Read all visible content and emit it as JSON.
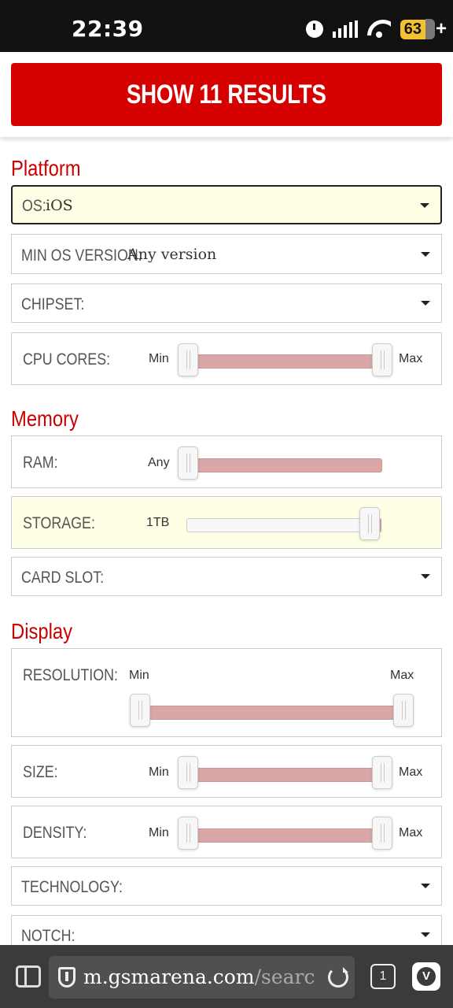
{
  "status_bar": {
    "time": "22:39",
    "battery_level": "63",
    "battery_plus": "+"
  },
  "top": {
    "show_results_label": "SHOW 11 RESULTS",
    "accent_color": "#d50000"
  },
  "sections": {
    "platform": {
      "title": "Platform",
      "os_label": "OS:",
      "os_value": "iOS",
      "min_os_label": "MIN OS VERSION:",
      "min_os_value": "Any version",
      "chipset_label": "CHIPSET:",
      "cpu_cores_label": "CPU CORES:",
      "cpu_cores_min": "Min",
      "cpu_cores_max": "Max"
    },
    "memory": {
      "title": "Memory",
      "ram_label": "RAM:",
      "ram_value": "Any",
      "storage_label": "STORAGE:",
      "storage_value": "1TB",
      "card_slot_label": "CARD SLOT:"
    },
    "display": {
      "title": "Display",
      "resolution_label": "RESOLUTION:",
      "resolution_min": "Min",
      "resolution_max": "Max",
      "size_label": "SIZE:",
      "size_min": "Min",
      "size_max": "Max",
      "density_label": "DENSITY:",
      "density_min": "Min",
      "density_max": "Max",
      "technology_label": "TECHNOLOGY:",
      "notch_label": "NOTCH:"
    }
  },
  "browser": {
    "url_host": "m.gsmarena.com",
    "url_path": "/searc",
    "tab_count": "1",
    "app_icon_letter": "V"
  },
  "icons": [
    "alarm-icon",
    "signal-icon",
    "wifi-icon",
    "battery-icon",
    "dropdown-caret-icon",
    "panel-icon",
    "shield-icon",
    "reload-icon",
    "tabs-icon",
    "vivaldi-icon"
  ]
}
